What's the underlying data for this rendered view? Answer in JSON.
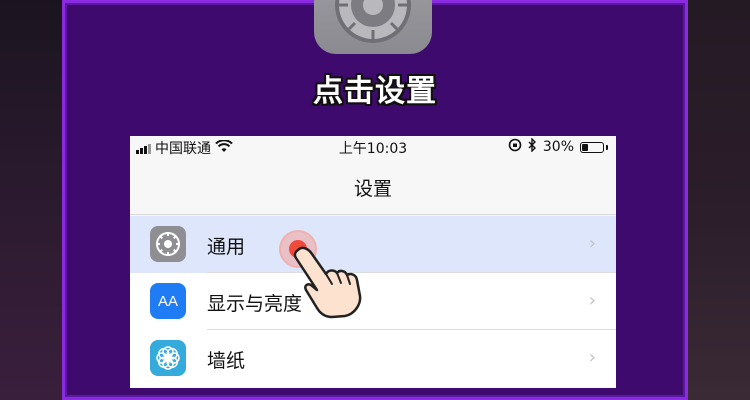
{
  "heading": "点击设置",
  "phone": {
    "status_bar": {
      "carrier": "中国联通",
      "time": "上午10:03",
      "battery": "30%",
      "battery_level": 0.3
    },
    "nav_title": "设置",
    "rows": [
      {
        "label": "通用",
        "icon": "gear-icon",
        "chevron": "›"
      },
      {
        "label": "显示与亮度",
        "icon": "text-size-icon",
        "icon_text": "AA",
        "chevron": "›"
      },
      {
        "label": "墙纸",
        "icon": "flower-icon",
        "chevron": "›"
      }
    ]
  },
  "colors": {
    "panel": "#3e0a6e",
    "panel_border": "#8a2be2",
    "highlight_row": "#dde6fa",
    "tap_dot": "#f04a3a"
  }
}
